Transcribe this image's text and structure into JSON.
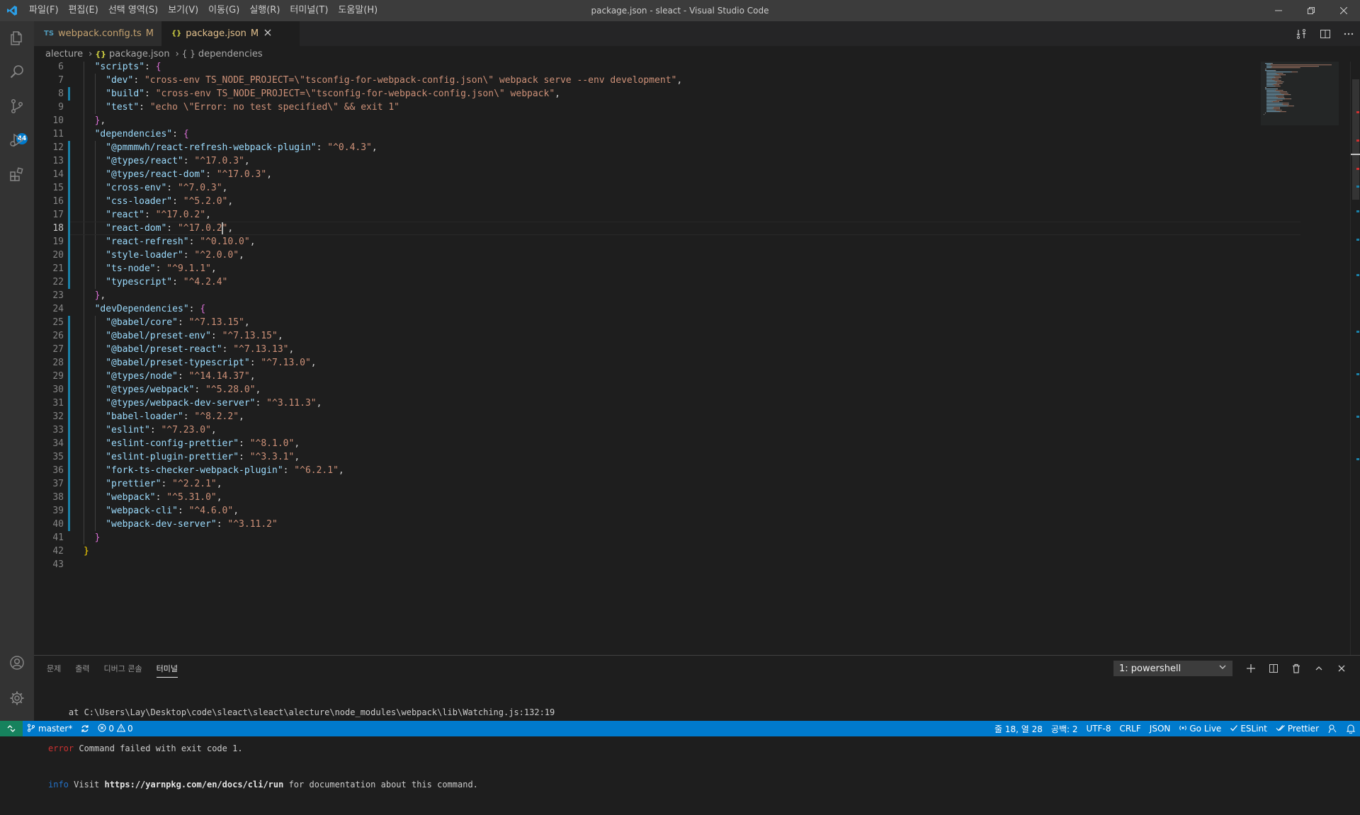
{
  "window": {
    "title": "package.json - sleact - Visual Studio Code"
  },
  "menu": [
    "파일(F)",
    "편집(E)",
    "선택 영역(S)",
    "보기(V)",
    "이동(G)",
    "실행(R)",
    "터미널(T)",
    "도움말(H)"
  ],
  "activity": {
    "scm_badge": "44"
  },
  "tabs": [
    {
      "icon_text": "TS",
      "label": "webpack.config.ts",
      "status": "M",
      "active": false
    },
    {
      "icon_text": "{}",
      "label": "package.json",
      "status": "M",
      "active": true
    }
  ],
  "breadcrumb": [
    "alecture",
    "package.json",
    "dependencies"
  ],
  "breadcrumb_icons": [
    "{}",
    "{ }"
  ],
  "editor": {
    "cursor_line": 18,
    "lines": [
      {
        "n": 6,
        "indent": 1,
        "parts": [
          [
            "k",
            "\"scripts\""
          ],
          [
            "p",
            ": "
          ],
          [
            "b2",
            "{"
          ]
        ]
      },
      {
        "n": 7,
        "indent": 2,
        "parts": [
          [
            "k",
            "\"dev\""
          ],
          [
            "p",
            ": "
          ],
          [
            "s",
            "\"cross-env TS_NODE_PROJECT=\\\"tsconfig-for-webpack-config.json\\\" webpack serve --env development\""
          ],
          [
            "p",
            ","
          ]
        ]
      },
      {
        "n": 8,
        "indent": 2,
        "parts": [
          [
            "k",
            "\"build\""
          ],
          [
            "p",
            ": "
          ],
          [
            "s",
            "\"cross-env TS_NODE_PROJECT=\\\"tsconfig-for-webpack-config.json\\\" webpack\""
          ],
          [
            "p",
            ","
          ]
        ]
      },
      {
        "n": 9,
        "indent": 2,
        "parts": [
          [
            "k",
            "\"test\""
          ],
          [
            "p",
            ": "
          ],
          [
            "s",
            "\"echo \\\"Error: no test specified\\\" && exit 1\""
          ]
        ]
      },
      {
        "n": 10,
        "indent": 1,
        "parts": [
          [
            "b2",
            "}"
          ],
          [
            "p",
            ","
          ]
        ]
      },
      {
        "n": 11,
        "indent": 1,
        "parts": [
          [
            "k",
            "\"dependencies\""
          ],
          [
            "p",
            ": "
          ],
          [
            "b2",
            "{"
          ]
        ]
      },
      {
        "n": 12,
        "indent": 2,
        "parts": [
          [
            "k",
            "\"@pmmmwh/react-refresh-webpack-plugin\""
          ],
          [
            "p",
            ": "
          ],
          [
            "s",
            "\"^0.4.3\""
          ],
          [
            "p",
            ","
          ]
        ]
      },
      {
        "n": 13,
        "indent": 2,
        "parts": [
          [
            "k",
            "\"@types/react\""
          ],
          [
            "p",
            ": "
          ],
          [
            "s",
            "\"^17.0.3\""
          ],
          [
            "p",
            ","
          ]
        ]
      },
      {
        "n": 14,
        "indent": 2,
        "parts": [
          [
            "k",
            "\"@types/react-dom\""
          ],
          [
            "p",
            ": "
          ],
          [
            "s",
            "\"^17.0.3\""
          ],
          [
            "p",
            ","
          ]
        ]
      },
      {
        "n": 15,
        "indent": 2,
        "parts": [
          [
            "k",
            "\"cross-env\""
          ],
          [
            "p",
            ": "
          ],
          [
            "s",
            "\"^7.0.3\""
          ],
          [
            "p",
            ","
          ]
        ]
      },
      {
        "n": 16,
        "indent": 2,
        "parts": [
          [
            "k",
            "\"css-loader\""
          ],
          [
            "p",
            ": "
          ],
          [
            "s",
            "\"^5.2.0\""
          ],
          [
            "p",
            ","
          ]
        ]
      },
      {
        "n": 17,
        "indent": 2,
        "parts": [
          [
            "k",
            "\"react\""
          ],
          [
            "p",
            ": "
          ],
          [
            "s",
            "\"^17.0.2\""
          ],
          [
            "p",
            ","
          ]
        ]
      },
      {
        "n": 18,
        "indent": 2,
        "parts": [
          [
            "k",
            "\"react-dom\""
          ],
          [
            "p",
            ": "
          ],
          [
            "s",
            "\"^17.0.2\""
          ],
          [
            "p",
            ","
          ]
        ]
      },
      {
        "n": 19,
        "indent": 2,
        "parts": [
          [
            "k",
            "\"react-refresh\""
          ],
          [
            "p",
            ": "
          ],
          [
            "s",
            "\"^0.10.0\""
          ],
          [
            "p",
            ","
          ]
        ]
      },
      {
        "n": 20,
        "indent": 2,
        "parts": [
          [
            "k",
            "\"style-loader\""
          ],
          [
            "p",
            ": "
          ],
          [
            "s",
            "\"^2.0.0\""
          ],
          [
            "p",
            ","
          ]
        ]
      },
      {
        "n": 21,
        "indent": 2,
        "parts": [
          [
            "k",
            "\"ts-node\""
          ],
          [
            "p",
            ": "
          ],
          [
            "s",
            "\"^9.1.1\""
          ],
          [
            "p",
            ","
          ]
        ]
      },
      {
        "n": 22,
        "indent": 2,
        "parts": [
          [
            "k",
            "\"typescript\""
          ],
          [
            "p",
            ": "
          ],
          [
            "s",
            "\"^4.2.4\""
          ]
        ]
      },
      {
        "n": 23,
        "indent": 1,
        "parts": [
          [
            "b2",
            "}"
          ],
          [
            "p",
            ","
          ]
        ]
      },
      {
        "n": 24,
        "indent": 1,
        "parts": [
          [
            "k",
            "\"devDependencies\""
          ],
          [
            "p",
            ": "
          ],
          [
            "b2",
            "{"
          ]
        ]
      },
      {
        "n": 25,
        "indent": 2,
        "parts": [
          [
            "k",
            "\"@babel/core\""
          ],
          [
            "p",
            ": "
          ],
          [
            "s",
            "\"^7.13.15\""
          ],
          [
            "p",
            ","
          ]
        ]
      },
      {
        "n": 26,
        "indent": 2,
        "parts": [
          [
            "k",
            "\"@babel/preset-env\""
          ],
          [
            "p",
            ": "
          ],
          [
            "s",
            "\"^7.13.15\""
          ],
          [
            "p",
            ","
          ]
        ]
      },
      {
        "n": 27,
        "indent": 2,
        "parts": [
          [
            "k",
            "\"@babel/preset-react\""
          ],
          [
            "p",
            ": "
          ],
          [
            "s",
            "\"^7.13.13\""
          ],
          [
            "p",
            ","
          ]
        ]
      },
      {
        "n": 28,
        "indent": 2,
        "parts": [
          [
            "k",
            "\"@babel/preset-typescript\""
          ],
          [
            "p",
            ": "
          ],
          [
            "s",
            "\"^7.13.0\""
          ],
          [
            "p",
            ","
          ]
        ]
      },
      {
        "n": 29,
        "indent": 2,
        "parts": [
          [
            "k",
            "\"@types/node\""
          ],
          [
            "p",
            ": "
          ],
          [
            "s",
            "\"^14.14.37\""
          ],
          [
            "p",
            ","
          ]
        ]
      },
      {
        "n": 30,
        "indent": 2,
        "parts": [
          [
            "k",
            "\"@types/webpack\""
          ],
          [
            "p",
            ": "
          ],
          [
            "s",
            "\"^5.28.0\""
          ],
          [
            "p",
            ","
          ]
        ]
      },
      {
        "n": 31,
        "indent": 2,
        "parts": [
          [
            "k",
            "\"@types/webpack-dev-server\""
          ],
          [
            "p",
            ": "
          ],
          [
            "s",
            "\"^3.11.3\""
          ],
          [
            "p",
            ","
          ]
        ]
      },
      {
        "n": 32,
        "indent": 2,
        "parts": [
          [
            "k",
            "\"babel-loader\""
          ],
          [
            "p",
            ": "
          ],
          [
            "s",
            "\"^8.2.2\""
          ],
          [
            "p",
            ","
          ]
        ]
      },
      {
        "n": 33,
        "indent": 2,
        "parts": [
          [
            "k",
            "\"eslint\""
          ],
          [
            "p",
            ": "
          ],
          [
            "s",
            "\"^7.23.0\""
          ],
          [
            "p",
            ","
          ]
        ]
      },
      {
        "n": 34,
        "indent": 2,
        "parts": [
          [
            "k",
            "\"eslint-config-prettier\""
          ],
          [
            "p",
            ": "
          ],
          [
            "s",
            "\"^8.1.0\""
          ],
          [
            "p",
            ","
          ]
        ]
      },
      {
        "n": 35,
        "indent": 2,
        "parts": [
          [
            "k",
            "\"eslint-plugin-prettier\""
          ],
          [
            "p",
            ": "
          ],
          [
            "s",
            "\"^3.3.1\""
          ],
          [
            "p",
            ","
          ]
        ]
      },
      {
        "n": 36,
        "indent": 2,
        "parts": [
          [
            "k",
            "\"fork-ts-checker-webpack-plugin\""
          ],
          [
            "p",
            ": "
          ],
          [
            "s",
            "\"^6.2.1\""
          ],
          [
            "p",
            ","
          ]
        ]
      },
      {
        "n": 37,
        "indent": 2,
        "parts": [
          [
            "k",
            "\"prettier\""
          ],
          [
            "p",
            ": "
          ],
          [
            "s",
            "\"^2.2.1\""
          ],
          [
            "p",
            ","
          ]
        ]
      },
      {
        "n": 38,
        "indent": 2,
        "parts": [
          [
            "k",
            "\"webpack\""
          ],
          [
            "p",
            ": "
          ],
          [
            "s",
            "\"^5.31.0\""
          ],
          [
            "p",
            ","
          ]
        ]
      },
      {
        "n": 39,
        "indent": 2,
        "parts": [
          [
            "k",
            "\"webpack-cli\""
          ],
          [
            "p",
            ": "
          ],
          [
            "s",
            "\"^4.6.0\""
          ],
          [
            "p",
            ","
          ]
        ]
      },
      {
        "n": 40,
        "indent": 2,
        "parts": [
          [
            "k",
            "\"webpack-dev-server\""
          ],
          [
            "p",
            ": "
          ],
          [
            "s",
            "\"^3.11.2\""
          ]
        ]
      },
      {
        "n": 41,
        "indent": 1,
        "parts": [
          [
            "b2",
            "}"
          ]
        ]
      },
      {
        "n": 42,
        "indent": 0,
        "parts": [
          [
            "b1",
            "}"
          ]
        ]
      },
      {
        "n": 43,
        "indent": 0,
        "parts": []
      }
    ]
  },
  "panel": {
    "tabs": [
      "문제",
      "출력",
      "디버그 콘솔",
      "터미널"
    ],
    "active_tab": 3,
    "terminal_select": "1: powershell",
    "lines": [
      {
        "prefix": "",
        "prefix_type": "",
        "text": "    at C:\\Users\\Lay\\Desktop\\code\\sleact\\sleact\\alecture\\node_modules\\webpack\\lib\\Watching.js:132:19",
        "bold": "",
        "suffix": ""
      },
      {
        "prefix": "error",
        "prefix_type": "err",
        "text": " Command failed with exit code 1.",
        "bold": "",
        "suffix": ""
      },
      {
        "prefix": "info",
        "prefix_type": "info",
        "text": " Visit ",
        "bold": "https://yarnpkg.com/en/docs/cli/run",
        "suffix": " for documentation about this command."
      }
    ]
  },
  "statusbar": {
    "branch": "master*",
    "errors": "0",
    "warnings": "0",
    "position": "줄 18, 열 28",
    "spaces": "공백: 2",
    "encoding": "UTF-8",
    "eol": "CRLF",
    "language": "JSON",
    "golive": "Go Live",
    "eslint": "ESLint",
    "prettier": "Prettier"
  },
  "colors": {
    "accent": "#007acc",
    "key": "#9cdcfe",
    "string": "#ce9178",
    "modified": "#e2c08d"
  }
}
